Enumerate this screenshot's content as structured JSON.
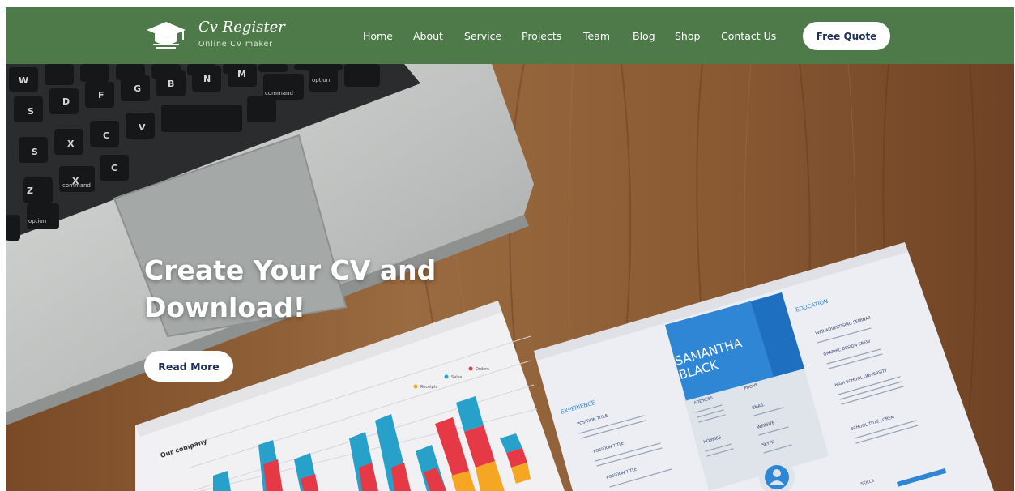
{
  "brand": {
    "title": "Cv Register",
    "subtitle": "Online CV maker"
  },
  "nav": {
    "items": [
      {
        "label": "Home",
        "name": "nav-home"
      },
      {
        "label": "About",
        "name": "nav-about"
      },
      {
        "label": "Service",
        "name": "nav-service"
      },
      {
        "label": "Projects",
        "name": "nav-projects"
      },
      {
        "label": "Team",
        "name": "nav-team"
      },
      {
        "label": "Blog",
        "name": "nav-blog"
      },
      {
        "label": "Shop",
        "name": "nav-shop"
      },
      {
        "label": "Contact Us",
        "name": "nav-contact-us"
      }
    ],
    "cta_label": "Free Quote"
  },
  "hero": {
    "title": "Create Your CV and Download!",
    "button_label": "Read More"
  },
  "photo": {
    "keys_row1": [
      "W",
      "S",
      "D",
      "F",
      "G",
      "B",
      "N",
      "M"
    ],
    "keys_row2": [
      "S",
      "D",
      "X",
      "C",
      "V",
      "B"
    ],
    "key_command": "command",
    "key_option": "option",
    "chart_title": "Our company",
    "chart_legend": [
      "Receipts",
      "Sales",
      "Orders"
    ],
    "resume_name": [
      "SAMANTHA",
      "BLACK"
    ],
    "resume_sections": [
      "EXPERIENCE",
      "EDUCATION",
      "ADDRESS",
      "PHONE",
      "EMAIL",
      "WEBSITE",
      "SKYPE",
      "HOBBIES",
      "SKILLS"
    ],
    "resume_positions": [
      "POSITION TITLE",
      "POSITION TITLE",
      "POSITION TITLE"
    ],
    "resume_education": [
      "WEB ADVERTISING SEMINAR",
      "GRAPHIC DESIGN CREW",
      "HIGH SCHOOL UNIVERSITY",
      "SCHOOL TITLE LOREM"
    ]
  },
  "colors": {
    "navbar": "#4e7a4a",
    "button_text": "#1f2f55",
    "wood": "#8a5a33"
  }
}
